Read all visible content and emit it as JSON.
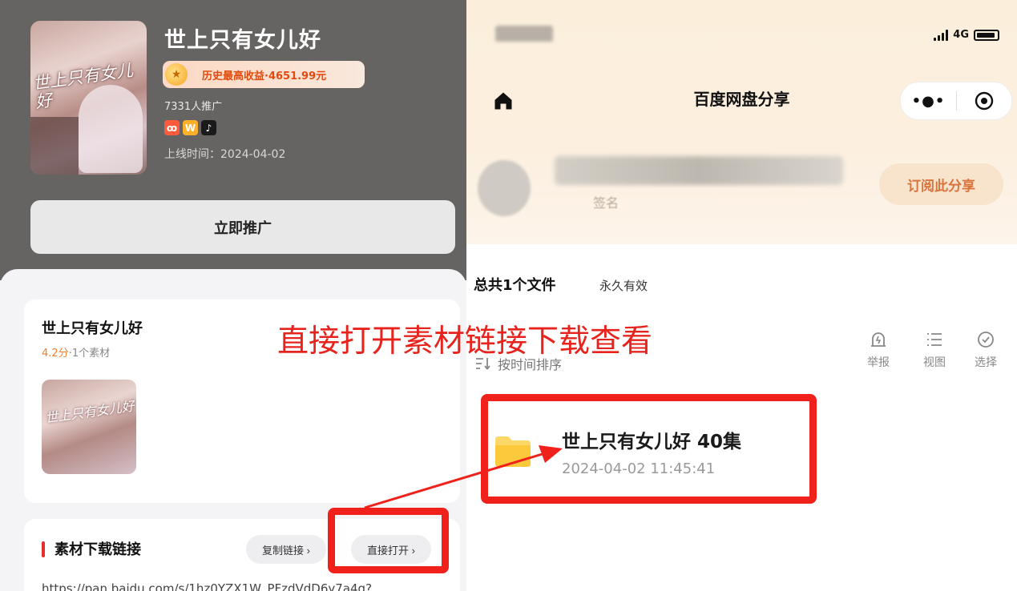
{
  "left": {
    "drama": {
      "cover_title": "世上只有女儿好",
      "title": "世上只有女儿好",
      "revenue": "历史最高收益·4651.99元",
      "promo_count": "7331人推广",
      "platforms": [
        "kuaishou",
        "wx",
        "douyin"
      ],
      "online_date": "上线时间：2024-04-02",
      "promote_label": "立即推广"
    },
    "material": {
      "title": "世上只有女儿好",
      "score": "4.2分",
      "count": "·1个素材",
      "thumb_title": "世上只有女儿好"
    },
    "download": {
      "title": "素材下载链接",
      "copy_label": "复制链接 ›",
      "open_label": "直接打开 ›",
      "url": "https://pan.baidu.com/s/1hz0YZX1W_PFzdVdD6y7a4g?"
    }
  },
  "right": {
    "status": {
      "network": "4G"
    },
    "nav": {
      "title": "百度网盘分享",
      "more": "•●•"
    },
    "profile": {
      "signature": "签名",
      "subscribe_label": "订阅此分享"
    },
    "summary": {
      "files": "总共1个文件",
      "validity": "永久有效"
    },
    "sort_label": "按时间排序",
    "tools": [
      {
        "icon": "report-icon",
        "label": "举报"
      },
      {
        "icon": "list-view-icon",
        "label": "视图"
      },
      {
        "icon": "check-circle-icon",
        "label": "选择"
      }
    ],
    "folder": {
      "name": "世上只有女儿好 40集",
      "time": "2024-04-02 11:45:41"
    }
  },
  "annotation": {
    "text": "直接打开素材链接下载查看",
    "color": "#e6231d"
  }
}
